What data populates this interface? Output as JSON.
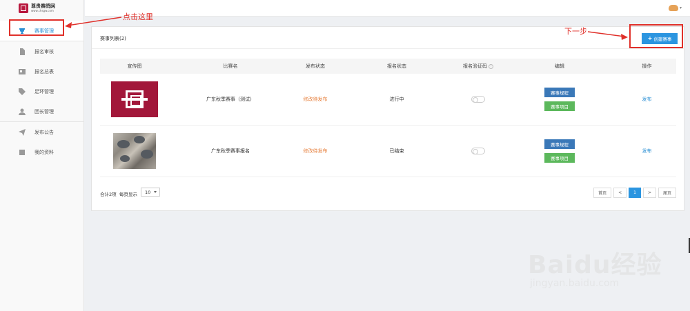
{
  "brand": {
    "title": "尊贵赛鸽网",
    "url": "www.chsgw.com"
  },
  "sidebar": {
    "items": [
      {
        "label": "赛事管理",
        "icon": "trophy-icon",
        "active": true
      },
      {
        "label": "报名审核",
        "icon": "document-icon"
      },
      {
        "label": "报名总表",
        "icon": "id-card-icon"
      },
      {
        "label": "足环管理",
        "icon": "tag-icon"
      },
      {
        "label": "团长管理",
        "icon": "user-icon"
      },
      {
        "label": "发布公告",
        "icon": "paper-plane-icon"
      },
      {
        "label": "我的资料",
        "icon": "book-icon"
      }
    ]
  },
  "panel": {
    "title": "赛事列表(2)",
    "create_label": "创建赛事"
  },
  "table": {
    "headers": [
      "宣传图",
      "比赛名",
      "发布状态",
      "报名状态",
      "报名验证码",
      "编辑",
      "操作"
    ],
    "rows": [
      {
        "name": "广东秋季赛事（测试）",
        "publish_status": "修改待发布",
        "signup_status": "进行中",
        "captcha_enabled": false,
        "rule_label": "赛事规程",
        "item_label": "赛事项目",
        "action": "发布"
      },
      {
        "name": "广东秋季赛事报名",
        "publish_status": "修改待发布",
        "signup_status": "已结束",
        "captcha_enabled": false,
        "rule_label": "赛事规程",
        "item_label": "赛事项目",
        "action": "发布"
      }
    ]
  },
  "footer": {
    "total": "合计2项",
    "per_page_label": "每页显示",
    "per_page_value": "10",
    "pager": {
      "first": "首页",
      "prev": "<",
      "current": "1",
      "next": ">",
      "last": "尾页"
    }
  },
  "annotations": {
    "click_here": "点击这里",
    "next_step": "下一步"
  },
  "watermark": {
    "brand": "Baidu经验",
    "site": "jingyan.baidu.com"
  },
  "colors": {
    "primary": "#2b95e0",
    "rule_button": "#3a78b8",
    "item_button": "#5cb85c",
    "publish_status": "#e67e3a",
    "annotation": "#e0302a"
  }
}
